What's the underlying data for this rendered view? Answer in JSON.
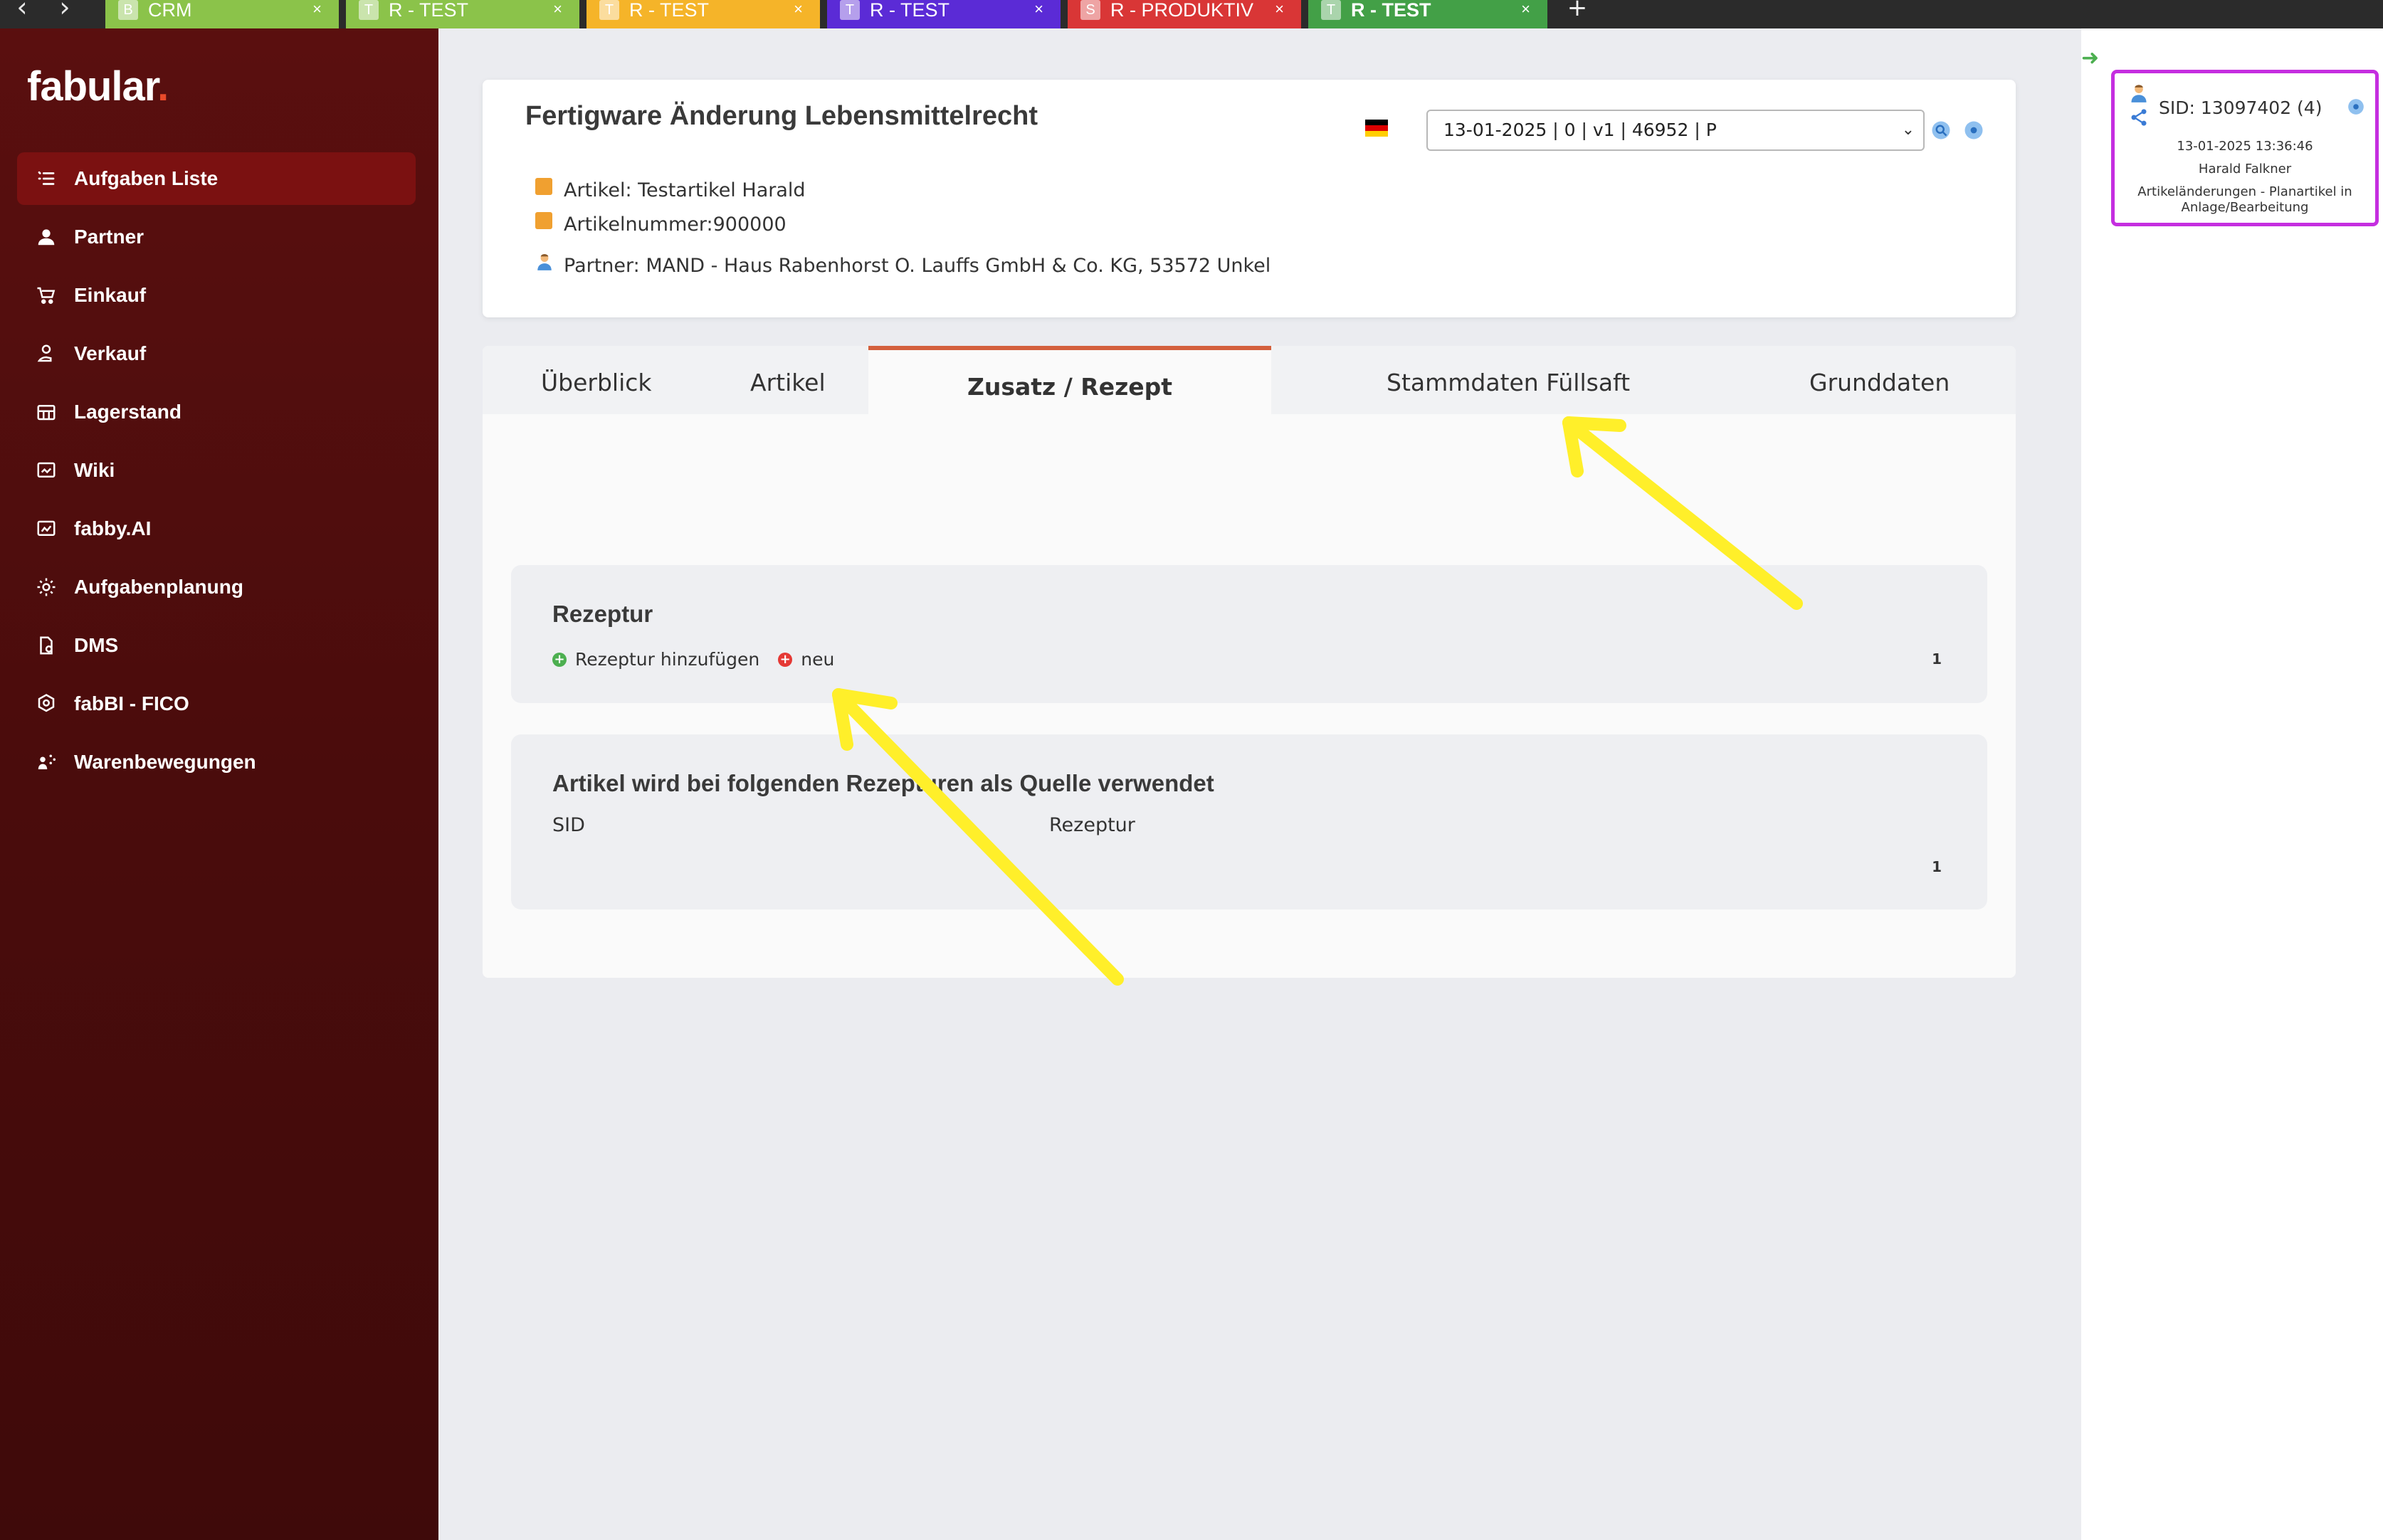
{
  "browser": {
    "tabs": [
      {
        "badge": "B",
        "label": "CRM",
        "color": "#8bc34a"
      },
      {
        "badge": "T",
        "label": "R - TEST",
        "color": "#8bc34a"
      },
      {
        "badge": "T",
        "label": "R - TEST",
        "color": "#f5b429"
      },
      {
        "badge": "T",
        "label": "R - TEST",
        "color": "#5b2bd6"
      },
      {
        "badge": "S",
        "label": "R - PRODUKTIV",
        "color": "#d93636"
      },
      {
        "badge": "T",
        "label": "R - TEST",
        "color": "#43a047"
      }
    ],
    "close_glyph": "×",
    "add_glyph": "+",
    "back_glyph": "‹",
    "forward_glyph": "›"
  },
  "app": {
    "logo": "fabular",
    "logo_dot": "."
  },
  "sidebar": {
    "items": [
      {
        "label": "Aufgaben Liste",
        "icon": "list-icon"
      },
      {
        "label": "Partner",
        "icon": "person-icon"
      },
      {
        "label": "Einkauf",
        "icon": "cart-icon"
      },
      {
        "label": "Verkauf",
        "icon": "sales-icon"
      },
      {
        "label": "Lagerstand",
        "icon": "warehouse-icon"
      },
      {
        "label": "Wiki",
        "icon": "wiki-icon"
      },
      {
        "label": "fabby.AI",
        "icon": "ai-icon"
      },
      {
        "label": "Aufgabenplanung",
        "icon": "gear-icon"
      },
      {
        "label": "DMS",
        "icon": "document-icon"
      },
      {
        "label": "fabBI - FICO",
        "icon": "bi-icon"
      },
      {
        "label": "Warenbewegungen",
        "icon": "movement-icon"
      }
    ]
  },
  "header": {
    "title": "Fertigware Änderung Lebensmittelrecht",
    "version_select_value": "13-01-2025 | 0 | v1 | 46952 | P",
    "artikel": "Artikel: Testartikel Harald",
    "artikelnummer": "Artikelnummer:900000",
    "partner": "Partner: MAND - Haus Rabenhorst O. Lauffs GmbH & Co. KG, 53572 Unkel"
  },
  "tabs": [
    {
      "label": "Überblick"
    },
    {
      "label": "Artikel"
    },
    {
      "label": "Zusatz / Rezept"
    },
    {
      "label": "Stammdaten Füllsaft"
    },
    {
      "label": "Grunddaten"
    }
  ],
  "rezeptur": {
    "title": "Rezeptur",
    "add_label": "Rezeptur hinzufügen",
    "new_label": "neu",
    "page": "1"
  },
  "quelle": {
    "title": "Artikel wird bei folgenden Rezepturen als Quelle verwendet",
    "col_sid": "SID",
    "col_rezeptur": "Rezeptur",
    "page": "1"
  },
  "sid_panel": {
    "title": "SID: 13097402 (4)",
    "date": "13-01-2025 13:36:46",
    "user": "Harald Falkner",
    "desc_line1": "Artikeländerungen - Planartikel in",
    "desc_line2": "Anlage/Bearbeitung"
  },
  "colors": {
    "sidebar_bg": "#4a0c0c",
    "sidebar_active": "#7b1111",
    "accent_tab": "#d4603d",
    "sid_border": "#c52ee0",
    "annotation": "#ffef2a"
  }
}
